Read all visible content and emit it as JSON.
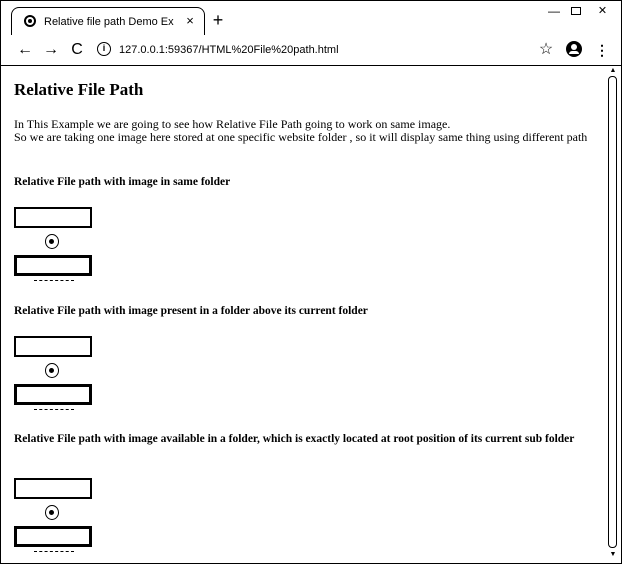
{
  "browser": {
    "tab_title": "Relative file path Demo Example",
    "tab_close": "×",
    "new_tab": "+",
    "window_minimize": "—",
    "window_close": "✕",
    "url": "127.0.0.1:59367/HTML%20File%20path.html",
    "icons": {
      "back": "←",
      "forward": "→",
      "reload": "C",
      "info": "i",
      "star": "☆",
      "menu": "⋮"
    }
  },
  "page": {
    "title": "Relative File Path",
    "intro_line1": "In This Example we are going to see how Relative File Path going to work on same image.",
    "intro_line2": "So we are taking one image here stored at one specific website folder , so it will display same thing using different path",
    "sections": [
      {
        "heading": "Relative File path with image in same folder"
      },
      {
        "heading": "Relative File path with image present in a folder above its current folder"
      },
      {
        "heading": "Relative File path with image available in a folder, which is exactly located at root position of its current sub folder"
      }
    ]
  },
  "scrollbar": {
    "up_arrow": "▲",
    "down_arrow": "▼"
  }
}
